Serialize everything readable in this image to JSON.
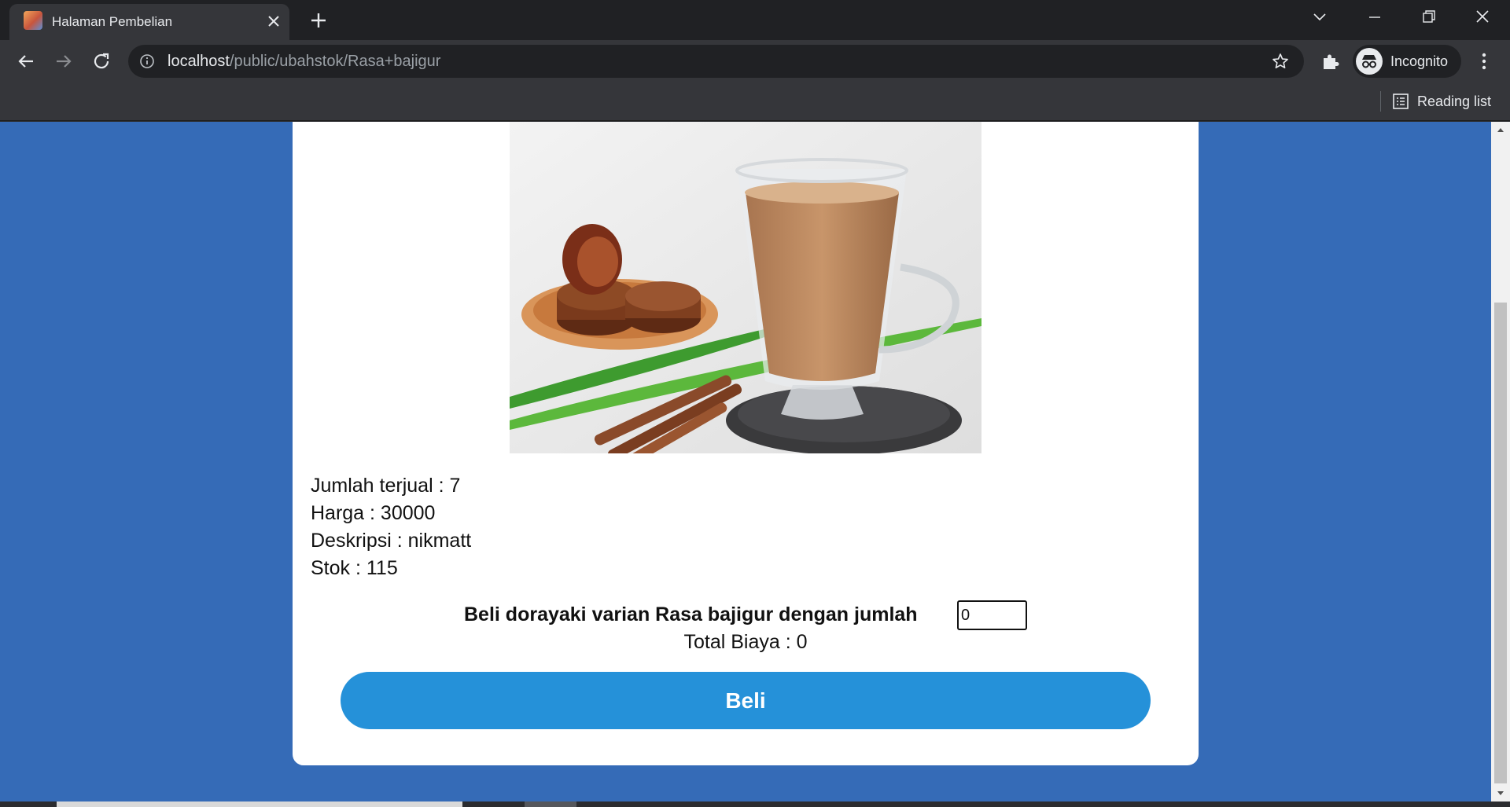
{
  "browser": {
    "tab_title": "Halaman Pembelian",
    "url_host": "localhost",
    "url_path": "/public/ubahstok/Rasa+bajigur",
    "profile_label": "Incognito",
    "reading_list_label": "Reading list"
  },
  "product": {
    "image_alt": "Rasa bajigur",
    "sold_line": "Jumlah terjual : 7",
    "price_line": "Harga : 30000",
    "description_line": "Deskripsi : nikmatt",
    "stock_line": "Stok : 115"
  },
  "purchase": {
    "prompt": "Beli dorayaki varian Rasa bajigur dengan jumlah",
    "quantity_value": "0",
    "total_line": "Total Biaya : 0",
    "buy_label": "Beli"
  },
  "colors": {
    "page_background": "#356bb7",
    "buy_button": "#2591d9",
    "chrome_dark": "#202124",
    "chrome_toolbar": "#35363a"
  }
}
